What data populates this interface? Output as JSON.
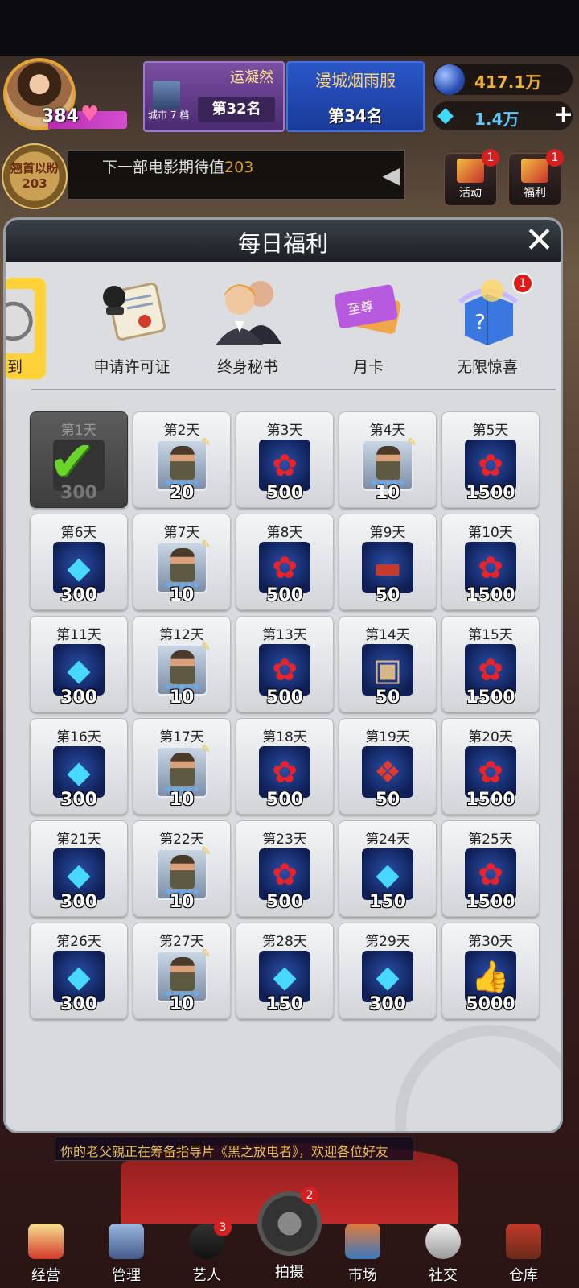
{
  "topbar": {
    "level": "384",
    "company_name": "运凝然",
    "city_label": "城市 7 档",
    "company_rank": "第32名",
    "region_name": "漫城烟雨服",
    "region_rank": "第34名",
    "coins": "417.1万",
    "gems": "1.4万",
    "plus": "+"
  },
  "secondrow": {
    "badge_line1": "翘首以盼",
    "badge_line2": "203",
    "news_prefix": "下一部电影期待值",
    "news_value": "203",
    "side_buttons": [
      {
        "label": "活动",
        "badge": "1"
      },
      {
        "label": "福利",
        "badge": "1"
      }
    ]
  },
  "modal": {
    "title": "每日福利",
    "close": "✕",
    "tabs": [
      {
        "label": "到"
      },
      {
        "label": "申请许可证"
      },
      {
        "label": "终身秘书"
      },
      {
        "label": "月卡"
      },
      {
        "label": "无限惊喜",
        "badge": "1"
      }
    ],
    "days": [
      {
        "day": "第1天",
        "item": "claimed",
        "qty": "300"
      },
      {
        "day": "第2天",
        "item": "star-card",
        "qty": "20"
      },
      {
        "day": "第3天",
        "item": "rose",
        "qty": "500"
      },
      {
        "day": "第4天",
        "item": "star-card",
        "qty": "10"
      },
      {
        "day": "第5天",
        "item": "rose",
        "qty": "1500"
      },
      {
        "day": "第6天",
        "item": "gem",
        "qty": "300"
      },
      {
        "day": "第7天",
        "item": "star-card",
        "qty": "10"
      },
      {
        "day": "第8天",
        "item": "rose",
        "qty": "500"
      },
      {
        "day": "第9天",
        "item": "brick",
        "qty": "50"
      },
      {
        "day": "第10天",
        "item": "rose",
        "qty": "1500"
      },
      {
        "day": "第11天",
        "item": "gem",
        "qty": "300"
      },
      {
        "day": "第12天",
        "item": "star-card",
        "qty": "10"
      },
      {
        "day": "第13天",
        "item": "rose",
        "qty": "500"
      },
      {
        "day": "第14天",
        "item": "card",
        "qty": "50"
      },
      {
        "day": "第15天",
        "item": "rose",
        "qty": "1500"
      },
      {
        "day": "第16天",
        "item": "gem",
        "qty": "300"
      },
      {
        "day": "第17天",
        "item": "star-card",
        "qty": "10"
      },
      {
        "day": "第18天",
        "item": "rose",
        "qty": "500"
      },
      {
        "day": "第19天",
        "item": "gift",
        "qty": "50"
      },
      {
        "day": "第20天",
        "item": "rose",
        "qty": "1500"
      },
      {
        "day": "第21天",
        "item": "gem",
        "qty": "300"
      },
      {
        "day": "第22天",
        "item": "star-card",
        "qty": "10"
      },
      {
        "day": "第23天",
        "item": "rose",
        "qty": "500"
      },
      {
        "day": "第24天",
        "item": "gem",
        "qty": "150"
      },
      {
        "day": "第25天",
        "item": "rose",
        "qty": "1500"
      },
      {
        "day": "第26天",
        "item": "gem",
        "qty": "300"
      },
      {
        "day": "第27天",
        "item": "star-card",
        "qty": "10"
      },
      {
        "day": "第28天",
        "item": "gem",
        "qty": "150"
      },
      {
        "day": "第29天",
        "item": "gem",
        "qty": "300"
      },
      {
        "day": "第30天",
        "item": "thumb",
        "qty": "5000"
      }
    ]
  },
  "ticker": "你的老父親正在筹备指导片《黑之放电者》，欢迎各位好友",
  "nav": [
    {
      "label": "经营",
      "icon": "popcorn-icon"
    },
    {
      "label": "管理",
      "icon": "manage-icon"
    },
    {
      "label": "艺人",
      "icon": "artist-icon",
      "badge": "3"
    },
    {
      "label": "拍摄",
      "icon": "camera-icon",
      "badge": "2"
    },
    {
      "label": "市场",
      "icon": "market-icon"
    },
    {
      "label": "社交",
      "icon": "social-icon"
    },
    {
      "label": "仓库",
      "icon": "warehouse-icon"
    }
  ],
  "colors": {
    "accent_gold": "#d4a020",
    "badge_red": "#d42020",
    "tab_highlight": "#ffd23a"
  }
}
